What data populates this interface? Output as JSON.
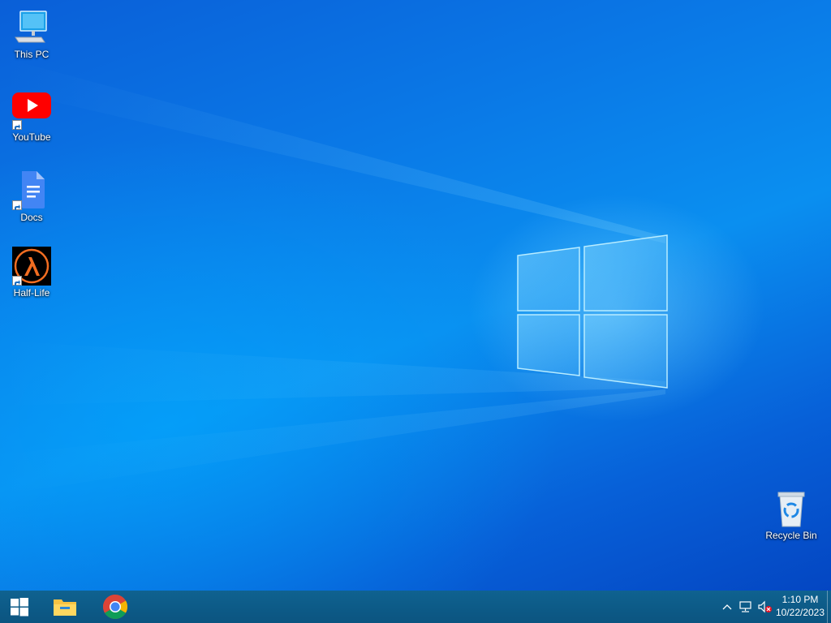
{
  "desktop": {
    "icons": [
      {
        "label": "This PC",
        "icon": "this-pc-icon"
      },
      {
        "label": "YouTube",
        "icon": "youtube-icon"
      },
      {
        "label": "Docs",
        "icon": "docs-icon"
      },
      {
        "label": "Half-Life",
        "icon": "half-life-icon"
      },
      {
        "label": "Recycle Bin",
        "icon": "recycle-bin-icon"
      }
    ]
  },
  "taskbar": {
    "start_icon": "windows-logo-icon",
    "pinned": [
      {
        "name": "File Explorer",
        "icon": "file-explorer-icon"
      },
      {
        "name": "Google Chrome",
        "icon": "chrome-icon"
      }
    ],
    "tray": {
      "icons": [
        "chevron-up-icon",
        "network-icon",
        "volume-muted-icon"
      ],
      "time": "1:10 PM",
      "date": "10/22/2023"
    }
  },
  "colors": {
    "taskbar": "#0b5480",
    "wallpaper_blue": "#0a78e6",
    "youtube_red": "#ff0000",
    "docs_blue": "#4285f4",
    "half_life_orange": "#f26d21"
  }
}
